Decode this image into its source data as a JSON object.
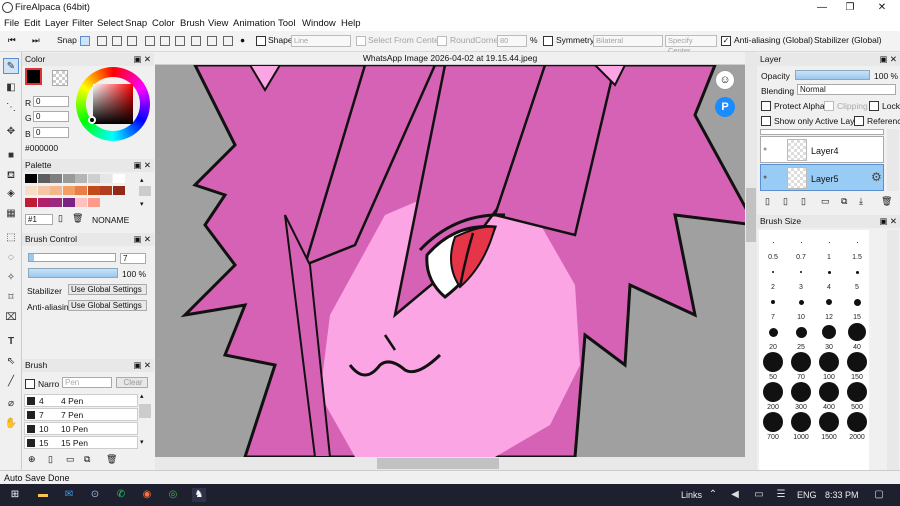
{
  "window": {
    "title": "FireAlpaca (64bit)"
  },
  "menu": [
    "File",
    "Edit",
    "Layer",
    "Filter",
    "Select",
    "Snap",
    "Color",
    "Brush",
    "View",
    "Animation",
    "Tool",
    "Window",
    "Help"
  ],
  "toolbar": {
    "snap": "Snap",
    "shape_label": "Shape",
    "shape_value": "Line",
    "select_from_center": "Select From Center",
    "round_corner": "RoundCorner",
    "round_corner_value": "80",
    "percent": "%",
    "symmetry": "Symmetry",
    "symmetry_value": "Bilateral",
    "specify_center": "Specify Center",
    "anti_aliasing_global": "Anti-aliasing (Global)",
    "stabilizer_global": "Stabilizer (Global)"
  },
  "color_panel": {
    "title": "Color",
    "r_label": "R",
    "g_label": "G",
    "b_label": "B",
    "r": "0",
    "g": "0",
    "b": "0",
    "hex": "#000000"
  },
  "palette_panel": {
    "title": "Palette",
    "number": "#1",
    "name": "NONAME",
    "colors": [
      "#000000",
      "#5e5e5e",
      "#7f7f7f",
      "#9a9a9a",
      "#b5b5b5",
      "#cfcfcf",
      "#e6e6e6",
      "#ffffff",
      "#f6ddc8",
      "#f3c7a5",
      "#f4b68a",
      "#f19f65",
      "#e97f44",
      "#c54a1a",
      "#b03e1f",
      "#8e2a16",
      "#c11c36",
      "#b3206a",
      "#9c2a7f",
      "#792382",
      "#ffc0c0",
      "#ff9a8a"
    ]
  },
  "brush_control": {
    "title": "Brush Control",
    "size": "7",
    "opacity": "100 %",
    "stabilizer_label": "Stabilizer",
    "stabilizer_value": "Use Global Settings",
    "anti_aliasing_label": "Anti-aliasin",
    "anti_aliasing_value": "Use Global Settings"
  },
  "brush_panel": {
    "title": "Brush",
    "narrow_label": "Narro",
    "search_placeholder": "Pen",
    "clear": "Clear",
    "items": [
      {
        "size": "4",
        "name": "4 Pen"
      },
      {
        "size": "7",
        "name": "7 Pen"
      },
      {
        "size": "10",
        "name": "10 Pen"
      },
      {
        "size": "15",
        "name": "15 Pen"
      }
    ]
  },
  "document": {
    "tab": "WhatsApp Image 2026-04-02 at 19.15.44.jpeg"
  },
  "layer_panel": {
    "title": "Layer",
    "opacity_label": "Opacity",
    "opacity_value": "100 %",
    "blending_label": "Blending",
    "blending_value": "Normal",
    "protect_alpha": "Protect Alpha",
    "clipping": "Clipping",
    "lock": "Lock",
    "show_only_active": "Show only Active Laye",
    "reference": "Referenc",
    "layers": [
      "Layer4",
      "Layer5"
    ]
  },
  "brush_size_panel": {
    "title": "Brush Size",
    "sizes": [
      "0.5",
      "0.7",
      "1",
      "1.5",
      "2",
      "3",
      "4",
      "5",
      "7",
      "10",
      "12",
      "15",
      "20",
      "25",
      "30",
      "40",
      "50",
      "70",
      "100",
      "150",
      "200",
      "300",
      "400",
      "500",
      "700",
      "1000",
      "1500",
      "2000"
    ]
  },
  "status": {
    "text": "Auto Save Done"
  },
  "taskbar": {
    "links": "Links",
    "lang": "ENG",
    "time": "8:33 PM"
  },
  "colors": {
    "hair": "#d662b6",
    "skin": "#fba5e5",
    "eye": "#e63549",
    "background": "#a0a0a0"
  }
}
